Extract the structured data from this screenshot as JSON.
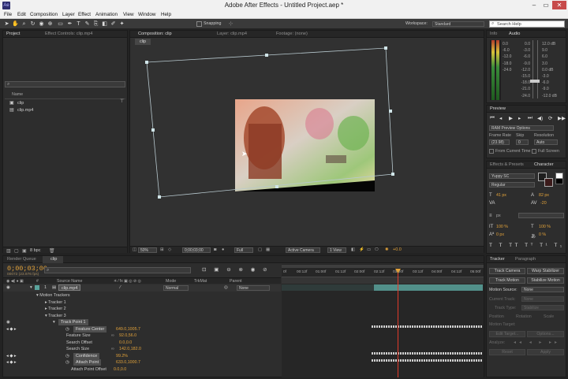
{
  "window": {
    "title": "Adobe After Effects - Untitled Project.aep *",
    "app_icon": "Ae",
    "min": "–",
    "max": "▭",
    "close": "✕"
  },
  "menu": [
    "File",
    "Edit",
    "Composition",
    "Layer",
    "Effect",
    "Animation",
    "View",
    "Window",
    "Help"
  ],
  "toolbar": {
    "snapping": "Snapping",
    "workspace_label": "Workspace:",
    "workspace_value": "Standard",
    "search_placeholder": "Search Help"
  },
  "project": {
    "tab": "Project",
    "effect_tab": "Effect Controls: clip.mp4",
    "col_name": "Name",
    "items": [
      {
        "name": "clip"
      },
      {
        "name": "clip.mp4"
      }
    ],
    "bpc": "8 bpc"
  },
  "comp": {
    "tab_comp": "Composition: clip",
    "tab_layer": "Layer: clip.mp4",
    "tab_footage": "Footage: (none)",
    "subtab": "clip",
    "zoom": "50%",
    "timecode": "0;00;03;00",
    "resolution": "Full",
    "camera": "Active Camera",
    "view": "1 View",
    "offset": "+0.0"
  },
  "info": {
    "tab_info": "Info",
    "tab_audio": "Audio",
    "left_scale": [
      "0.0",
      "-6.0",
      "-12.0",
      "-18.0",
      "-24.0"
    ],
    "db_left": [
      "0.0",
      "-3.0",
      "-6.0",
      "-9.0",
      "-12.0",
      "-15.0",
      "-18.0",
      "-21.0",
      "-24.0"
    ],
    "db_right": [
      "12.0 dB",
      "9.0",
      "6.0",
      "3.0",
      "0.0 dB",
      "-3.0",
      "-6.0",
      "-9.0",
      "-12.0 dB"
    ]
  },
  "preview": {
    "tab": "Preview",
    "ram_options": "RAM Preview Options",
    "frame_rate_label": "Frame Rate",
    "skip_label": "Skip",
    "resolution_label": "Resolution",
    "frame_rate": "(23.98)",
    "skip": "0",
    "resolution": "Auto",
    "from_current": "From Current Time",
    "full_screen": "Full Screen"
  },
  "effects": {
    "tab_effects": "Effects & Presets",
    "tab_character": "Character",
    "font": "Yuppy SC",
    "style": "Regular",
    "size": "41 px",
    "leading": "82 px",
    "tracking": "-20",
    "scale_v": "100 %",
    "scale_h": "100 %",
    "baseline": "0 px",
    "tsume": "0 %",
    "unit": "px"
  },
  "tracker": {
    "tab_tracker": "Tracker",
    "tab_paragraph": "Paragraph",
    "track_camera": "Track Camera",
    "warp_stabilizer": "Warp Stabilizer",
    "track_motion": "Track Motion",
    "stabilize_motion": "Stabilize Motion",
    "motion_source_label": "Motion Source:",
    "motion_source": "None",
    "current_track_label": "Current Track:",
    "current_track": "None",
    "track_type_label": "Track Type:",
    "track_type": "Stabilize",
    "position": "Position",
    "rotation": "Rotation",
    "scale": "Scale",
    "motion_target": "Motion Target:",
    "edit_target": "Edit Target...",
    "options": "Options...",
    "analyze": "Analyze:",
    "reset": "Reset",
    "apply": "Apply"
  },
  "timeline": {
    "tab_render": "Render Queue",
    "tab_clip": "clip",
    "timecode": "0;00;03;00",
    "frames": "00072 (23.976 fps)",
    "col_source": "Source Name",
    "col_mode": "Mode",
    "col_trkmat": "TrkMat",
    "col_parent": "Parent",
    "layer_num": "1",
    "layer_name": "clip.mp4",
    "layer_mode": "Normal",
    "layer_parent": "None",
    "ruler": [
      "0f",
      "00:12f",
      "01:00f",
      "01:12f",
      "02:00f",
      "02:12f",
      "03:00f",
      "03:12f",
      "04:00f",
      "04:12f",
      "05:00f"
    ],
    "rows": [
      {
        "label": "Motion Trackers",
        "value": ""
      },
      {
        "label": "Tracker 1",
        "value": ""
      },
      {
        "label": "Tracker 2",
        "value": ""
      },
      {
        "label": "Tracker 3",
        "value": ""
      },
      {
        "label": "Track Point 1",
        "value": ""
      },
      {
        "label": "Feature Center",
        "value": "649.0,1005.7"
      },
      {
        "label": "Feature Size",
        "value": "92.0,56.0"
      },
      {
        "label": "Search Offset",
        "value": "0.0,0.0"
      },
      {
        "label": "Search Size",
        "value": "142.0,182.0"
      },
      {
        "label": "Confidence",
        "value": "99.2%"
      },
      {
        "label": "Attach Point",
        "value": "633.0,1000.7"
      },
      {
        "label": "Attach Point Offset",
        "value": "0.0,0.0"
      }
    ]
  },
  "colors": {
    "accent": "#e2a23a",
    "playhead": "#e23b2b",
    "layer_bar": "#5aa39c"
  }
}
